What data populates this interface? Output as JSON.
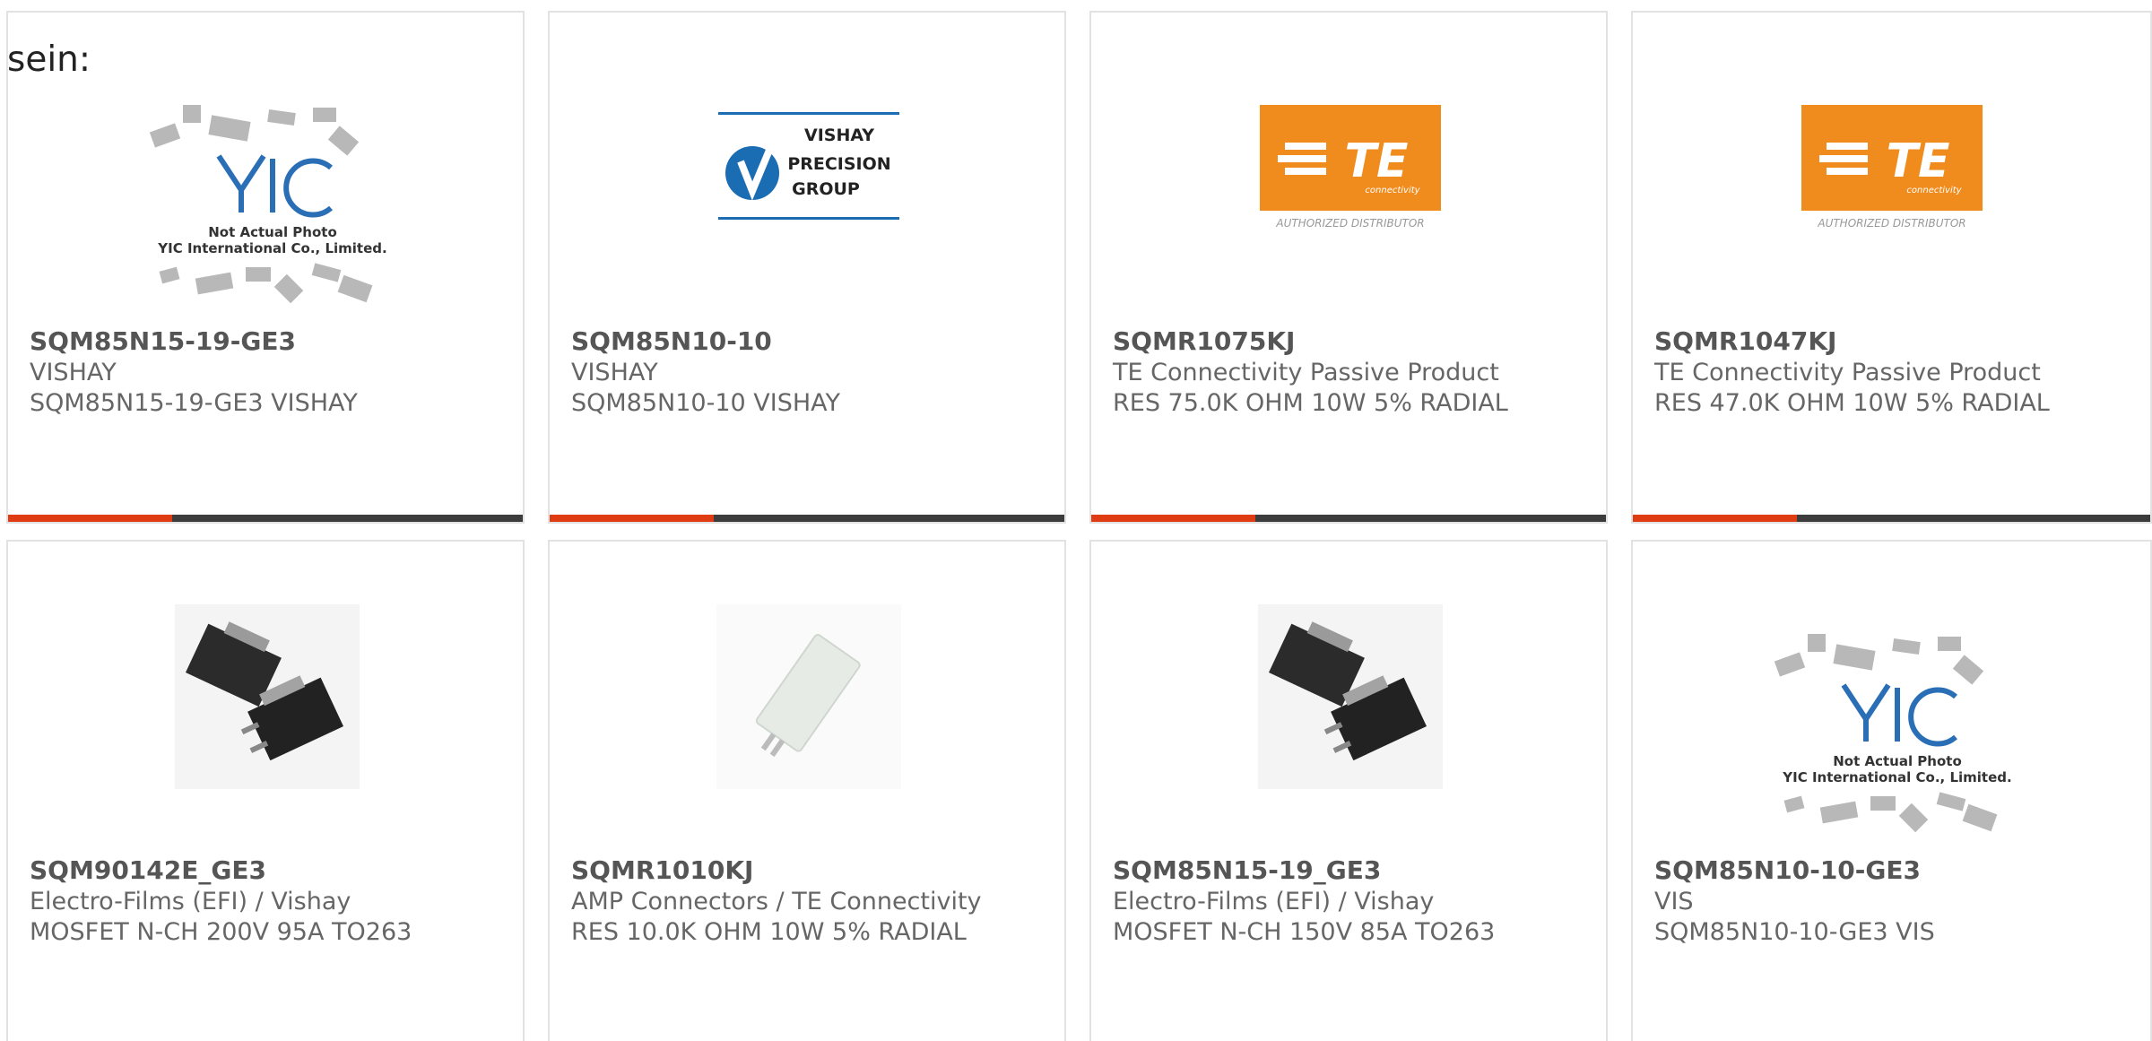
{
  "intro_text": "sein:",
  "colors": {
    "accent": "#e03c14",
    "bar": "#3c3c3c",
    "te_orange": "#f08c1e",
    "vishay_blue": "#1a6cb3"
  },
  "products": [
    {
      "part": "SQM85N15-19-GE3",
      "mfr": "VISHAY",
      "desc": "SQM85N15-19-GE3 VISHAY",
      "image": "yic-not-actual-photo",
      "image_text": {
        "line1": "Not Actual Photo",
        "line2": "YIC International Co., Limited."
      }
    },
    {
      "part": "SQM85N10-10",
      "mfr": "VISHAY",
      "desc": "SQM85N10-10 VISHAY",
      "image": "vishay-precision-logo",
      "image_text": {
        "line1": "VISHAY",
        "line2": "PRECISION",
        "line3": "GROUP"
      }
    },
    {
      "part": "SQMR1075KJ",
      "mfr": "TE Connectivity Passive Product",
      "desc": "RES 75.0K OHM 10W 5% RADIAL",
      "image": "te-logo",
      "image_text": {
        "brand": "TE",
        "sub": "connectivity",
        "caption": "AUTHORIZED DISTRIBUTOR"
      }
    },
    {
      "part": "SQMR1047KJ",
      "mfr": "TE Connectivity Passive Product",
      "desc": "RES 47.0K OHM 10W 5% RADIAL",
      "image": "te-logo",
      "image_text": {
        "brand": "TE",
        "sub": "connectivity",
        "caption": "AUTHORIZED DISTRIBUTOR"
      }
    },
    {
      "part": "SQM90142E_GE3",
      "mfr": "Electro-Films (EFI) / Vishay",
      "desc": "MOSFET N-CH 200V 95A TO263",
      "image": "to263-package-photo"
    },
    {
      "part": "SQMR1010KJ",
      "mfr": "AMP Connectors / TE Connectivity",
      "desc": "RES 10.0K OHM 10W 5% RADIAL",
      "image": "radial-resistor-photo"
    },
    {
      "part": "SQM85N15-19_GE3",
      "mfr": "Electro-Films (EFI) / Vishay",
      "desc": "MOSFET N-CH 150V 85A TO263",
      "image": "to263-package-photo"
    },
    {
      "part": "SQM85N10-10-GE3",
      "mfr": "VIS",
      "desc": "SQM85N10-10-GE3 VIS",
      "image": "yic-not-actual-photo",
      "image_text": {
        "line1": "Not Actual Photo",
        "line2": "YIC International Co., Limited."
      }
    }
  ]
}
